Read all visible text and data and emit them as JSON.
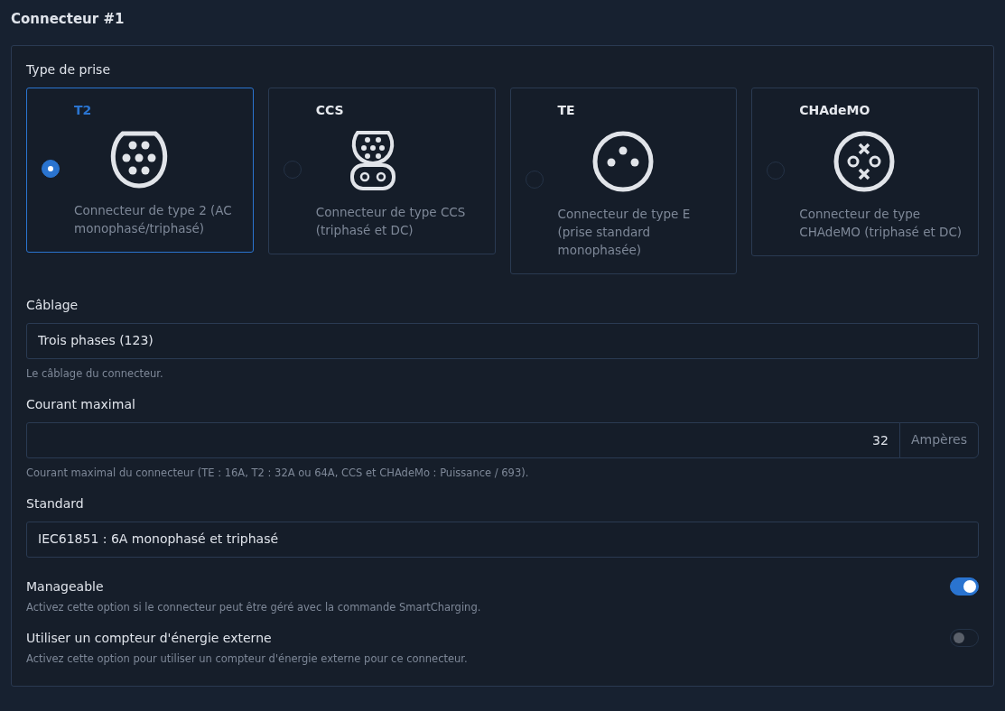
{
  "title": "Connecteur #1",
  "plug_type": {
    "label": "Type de prise",
    "options": [
      {
        "kind": "t2",
        "name": "T2",
        "description": "Connecteur de type 2 (AC monophasé/triphasé)",
        "selected": true
      },
      {
        "kind": "ccs",
        "name": "CCS",
        "description": "Connecteur de type CCS (triphasé et DC)",
        "selected": false
      },
      {
        "kind": "te",
        "name": "TE",
        "description": "Connecteur de type E (prise standard monophasée)",
        "selected": false
      },
      {
        "kind": "chademo",
        "name": "CHAdeMO",
        "description": "Connecteur de type CHAdeMO (triphasé et DC)",
        "selected": false
      }
    ]
  },
  "wiring": {
    "label": "Câblage",
    "value": "Trois phases (123)",
    "help": "Le câblage du connecteur."
  },
  "max_current": {
    "label": "Courant maximal",
    "value": "32",
    "unit": "Ampères",
    "help": "Courant maximal du connecteur (TE : 16A, T2 : 32A ou 64A, CCS et CHAdeMo : Puissance / 693)."
  },
  "standard": {
    "label": "Standard",
    "value": "IEC61851 : 6A monophasé et triphasé"
  },
  "switches": [
    {
      "label": "Manageable",
      "help": "Activez cette option si le connecteur peut être géré avec la commande SmartCharging.",
      "on": true
    },
    {
      "label": "Utiliser un compteur d'énergie externe",
      "help": "Activez cette option pour utiliser un compteur d'énergie externe pour ce connecteur.",
      "on": false
    }
  ]
}
